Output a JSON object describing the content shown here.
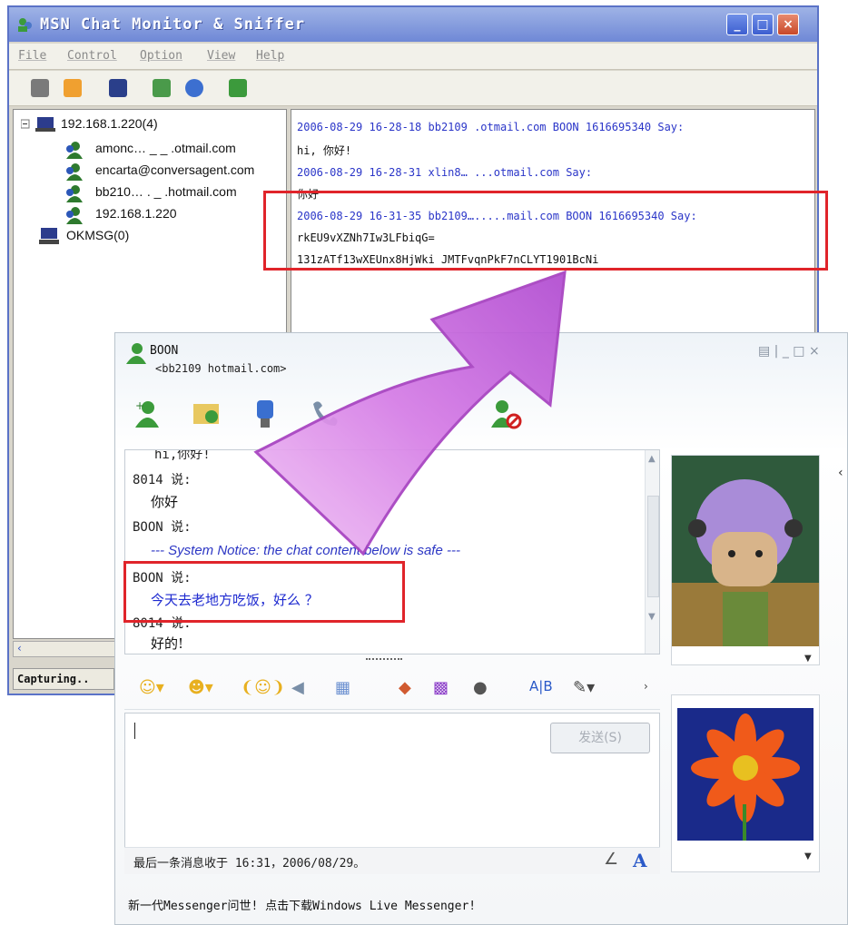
{
  "sniffer": {
    "title": "MSN Chat Monitor & Sniffer",
    "menu": [
      "File",
      "Control",
      "Option",
      "View",
      "Help"
    ],
    "toolbar_icons": [
      "start-icon",
      "pause-icon",
      "save-icon",
      "filter-icon",
      "help-icon",
      "exit-icon"
    ],
    "tree": {
      "root1": "192.168.1.220(4)",
      "children": [
        "amonc… _ _ .otmail.com",
        "encarta@conversagent.com",
        "bb210… . _ .hotmail.com",
        "192.168.1.220"
      ],
      "root2": "OKMSG(0)"
    },
    "log": [
      {
        "head": "2006-08-29 16-28-18  bb2109      .otmail.com BOON 1616695340  Say:",
        "body": [
          "hi, 你好!"
        ]
      },
      {
        "head": "2006-08-29 16-28-31  xlin8…  ...otmail.com    Say:",
        "body": [
          "你好"
        ]
      },
      {
        "head": "2006-08-29 16-31-35  bb2109….....mail.com BOON 1616695340  Say:",
        "body": [
          "rkEU9vXZNh7Iw3LFbiqG=",
          "131zATf13wXEUnx8HjWki JMTFvqnPkF7nCLYT1901BcNi"
        ]
      }
    ],
    "status": "Capturing.."
  },
  "messenger": {
    "contact_name": "BOON",
    "contact_email": "<bb2109     hotmail.com>",
    "window_controls": [
      "▤ | _ □ ×"
    ],
    "toolbar_icons": [
      "invite-icon",
      "share-files-icon",
      "video-icon",
      "call-icon",
      "activities-icon",
      "block-icon"
    ],
    "chat": {
      "top_partial": "hi,你好!",
      "lines": [
        {
          "kind": "name",
          "text": "8014 说:"
        },
        {
          "kind": "text",
          "text": "你好"
        },
        {
          "kind": "name",
          "text": "BOON 说:"
        },
        {
          "kind": "notice",
          "text": "--- System Notice: the chat content below is safe ---"
        },
        {
          "kind": "name",
          "text": "BOON 说:"
        },
        {
          "kind": "blue",
          "text": "今天去老地方吃饭，好么   ？"
        },
        {
          "kind": "name",
          "text": "8014 说:"
        },
        {
          "kind": "text",
          "text": "好的!"
        }
      ]
    },
    "format_icons": [
      "emoticon-icon",
      "wink-icon",
      "nudge-icon",
      "voice-clip-icon",
      "background-icon",
      "font-color-icon",
      "palette-icon",
      "gif-icon",
      "text-style-icon",
      "brush-icon",
      "more-icon"
    ],
    "send_label": "发送(S)",
    "status_text": "最后一条消息收于 16:31，2006/08/29。",
    "footer": "新一代Messenger问世! 点击下载Windows Live Messenger!"
  },
  "colors": {
    "highlight": "#e0242a",
    "arrow": "#d57be6",
    "log_head": "#2a35c8",
    "notice": "#2c36c4"
  }
}
